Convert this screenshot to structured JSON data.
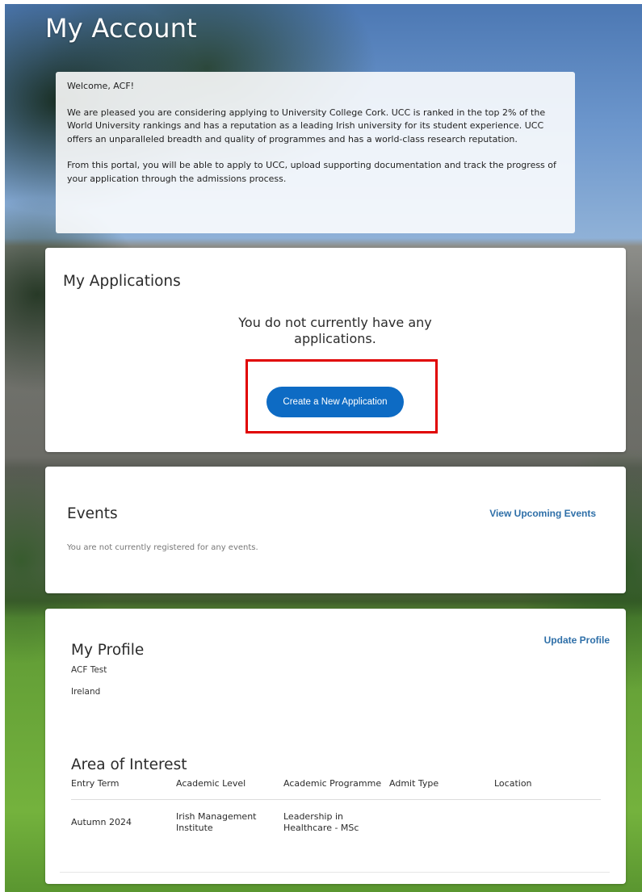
{
  "page": {
    "title": "My Account"
  },
  "welcome": {
    "greeting": "Welcome, ACF!",
    "paragraph1": "We are pleased you are considering applying to University College Cork. UCC is ranked in the top 2% of the World University rankings and has a reputation as a leading Irish university for its student experience. UCC offers an unparalleled breadth and quality of programmes and has a world-class research reputation.",
    "paragraph2": "From this portal, you will be able to apply to UCC, upload supporting documentation and track the progress of your application through the admissions process."
  },
  "applications": {
    "heading": "My Applications",
    "empty_message": "You do not currently have any applications.",
    "create_button_label": "Create a New Application"
  },
  "events": {
    "heading": "Events",
    "view_link_label": "View Upcoming Events",
    "empty_message": "You are not currently registered for any events."
  },
  "profile": {
    "heading": "My Profile",
    "update_link_label": "Update Profile",
    "name": "ACF Test",
    "country": "Ireland"
  },
  "area_of_interest": {
    "heading": "Area of Interest",
    "columns": [
      "Entry Term",
      "Academic Level",
      "Academic Programme",
      "Admit Type",
      "Location"
    ],
    "rows": [
      {
        "entry_term": "Autumn 2024",
        "academic_level": "Irish Management Institute",
        "academic_programme": "Leadership in Healthcare - MSc",
        "admit_type": "",
        "location": ""
      }
    ]
  },
  "colors": {
    "primary_button": "#0d6bc4",
    "link": "#2e6fa8",
    "highlight": "#e00000"
  }
}
